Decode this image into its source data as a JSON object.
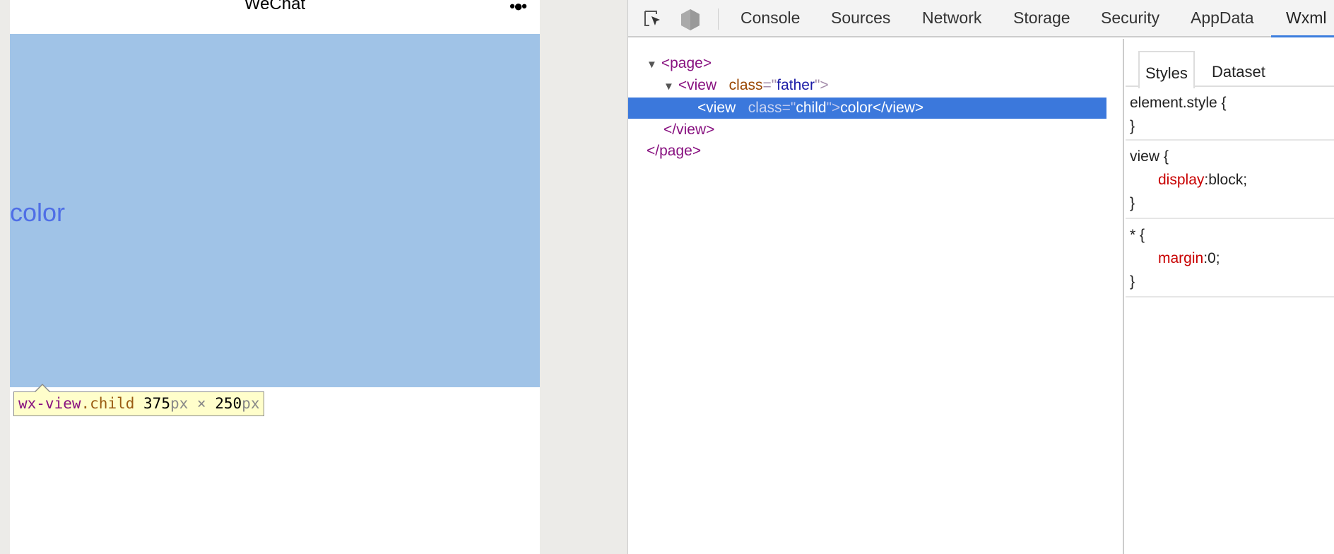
{
  "simulator": {
    "title": "WeChat",
    "menu_icon": "more-dots-icon",
    "child_text": "color",
    "child_bg": "#a0c3e7",
    "tooltip": {
      "tag": "wx-view",
      "cls": ".child",
      "width": "375",
      "w_unit": "px",
      "times": "×",
      "height": "250",
      "h_unit": "px"
    }
  },
  "devtools": {
    "toolbar": {
      "icons": [
        "inspect-cursor-icon",
        "hexagon-icon"
      ],
      "tabs": [
        "Console",
        "Sources",
        "Network",
        "Storage",
        "Security",
        "AppData",
        "Wxml"
      ],
      "active_tab": "Wxml"
    },
    "tree": {
      "page_open": "<page>",
      "view_open_tag": "<view",
      "attr_name": "class",
      "eq": "=\"",
      "father": "father",
      "close_q": "\">",
      "child_tag": "<view",
      "child_attr": "class",
      "child_val": "child",
      "child_text": "color",
      "child_close": "</view>",
      "view_close": "</view>",
      "page_close": "</page>"
    },
    "styles": {
      "tabs": [
        "Styles",
        "Dataset"
      ],
      "rules": [
        {
          "selector": "element.style {",
          "close": "}"
        },
        {
          "selector": "view {",
          "prop": "display",
          "value": ":block;",
          "close": "}"
        },
        {
          "selector": "* {",
          "prop": "margin",
          "value": ":0;",
          "close": "}"
        }
      ]
    }
  }
}
